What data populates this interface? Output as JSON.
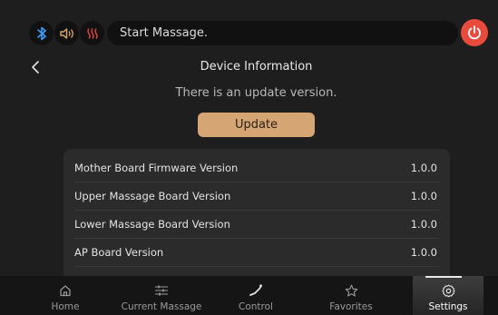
{
  "status": {
    "message": "Start Massage."
  },
  "header": {
    "title": "Device Information"
  },
  "update": {
    "notice": "There is an update version.",
    "button_label": "Update"
  },
  "versions": [
    {
      "label": "Mother Board Firmware Version",
      "value": "1.0.0"
    },
    {
      "label": "Upper Massage Board Version",
      "value": "1.0.0"
    },
    {
      "label": "Lower Massage Board Version",
      "value": "1.0.0"
    },
    {
      "label": "AP Board Version",
      "value": "1.0.0"
    }
  ],
  "nav": {
    "home": "Home",
    "current_massage": "Current Massage",
    "control": "Control",
    "favorites": "Favorites",
    "settings": "Settings"
  },
  "icons": {
    "bluetooth": "bluetooth-icon",
    "sound": "speaker-icon",
    "heat": "heat-icon",
    "power": "power-icon"
  },
  "colors": {
    "bluetooth": "#3aa0ff",
    "sound": "#e0a76a",
    "heat": "#e8483c",
    "power_button": "#e84b3c",
    "update_button": "#d6a574"
  }
}
